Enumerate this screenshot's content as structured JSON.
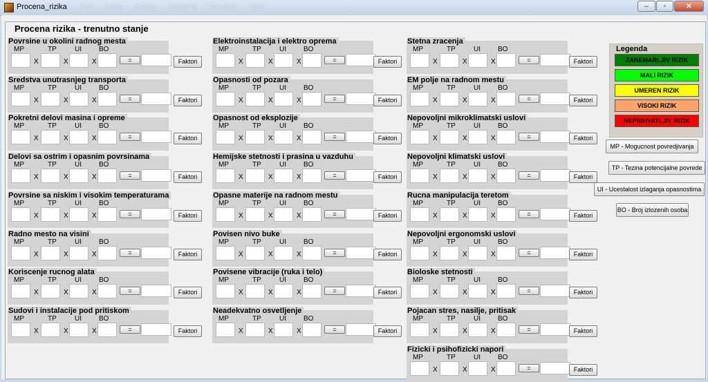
{
  "window": {
    "title": "Procena_rizika",
    "menu": [
      "File",
      "Tools",
      "Debug",
      "Desktop",
      "Window",
      "Help"
    ],
    "minimize": "–",
    "maximize": "▫",
    "close": "✕"
  },
  "group_title": "Procena rizika - trenutno stanje",
  "field_labels": {
    "mp": "MP",
    "tp": "TP",
    "ui": "UI",
    "bo": "BO"
  },
  "multiply_symbol": "X",
  "equals_label": "=",
  "faktori_label": "Faktori",
  "columns": [
    {
      "panels": [
        {
          "title": "Povrsine u okolini radnog mesta"
        },
        {
          "title": "Sredstva unutrasnjeg transporta"
        },
        {
          "title": "Pokretni delovi masina i opreme"
        },
        {
          "title": "Delovi sa ostrim i opasnim povrsinama"
        },
        {
          "title": "Povrsine sa niskim i visokim temperaturama"
        },
        {
          "title": "Radno mesto na visini"
        },
        {
          "title": "Koriscenje rucnog alata"
        },
        {
          "title": "Sudovi i instalacije pod pritiskom"
        }
      ]
    },
    {
      "panels": [
        {
          "title": "Elektroinstalacija i elektro oprema"
        },
        {
          "title": "Opasnosti od pozara"
        },
        {
          "title": "Opasnost od eksplozije"
        },
        {
          "title": "Hemijske stetnosti i prasina u vazduhu"
        },
        {
          "title": "Opasne materije na radnom mestu"
        },
        {
          "title": "Povisen nivo buke"
        },
        {
          "title": "Povisene vibracije (ruka i telo)"
        },
        {
          "title": "Neadekvatno osvetljenje"
        }
      ]
    },
    {
      "panels": [
        {
          "title": "Stetna zracenja"
        },
        {
          "title": "EM polje na radnom mestu"
        },
        {
          "title": "Nepovoljni mikroklimatski uslovi"
        },
        {
          "title": "Nepovoljni klimatski uslovi"
        },
        {
          "title": "Rucna manipulacija teretom"
        },
        {
          "title": "Nepovoljni ergonomski uslovi"
        },
        {
          "title": "Bioloske stetnosti"
        },
        {
          "title": "Pojacan stres, nasilje, pritisak"
        },
        {
          "title": "Fizicki i psihofizicki napori"
        }
      ]
    }
  ],
  "legend": {
    "title": "Legenda",
    "items": [
      {
        "label": "ZANEMARLJIV RIZIK",
        "bg": "#008000",
        "fg": "#000000"
      },
      {
        "label": "MALI RIZIK",
        "bg": "#00ff00",
        "fg": "#000000"
      },
      {
        "label": "UMEREN RIZIK",
        "bg": "#ffff00",
        "fg": "#000000"
      },
      {
        "label": "VISOKI RIZIK",
        "bg": "#ffa366",
        "fg": "#000000"
      },
      {
        "label": "NEPRIHVATLJIV RIZIK",
        "bg": "#ff0000",
        "fg": "#000000"
      }
    ]
  },
  "info_buttons": [
    {
      "label": "MP - Mogucnost povredjivanja"
    },
    {
      "label": "TP - Tezina potencijalne povrede"
    },
    {
      "label": "UI - Ucestalost izlaganja opasnostima"
    },
    {
      "label": "BO - Broj izlozenih osoba"
    }
  ]
}
